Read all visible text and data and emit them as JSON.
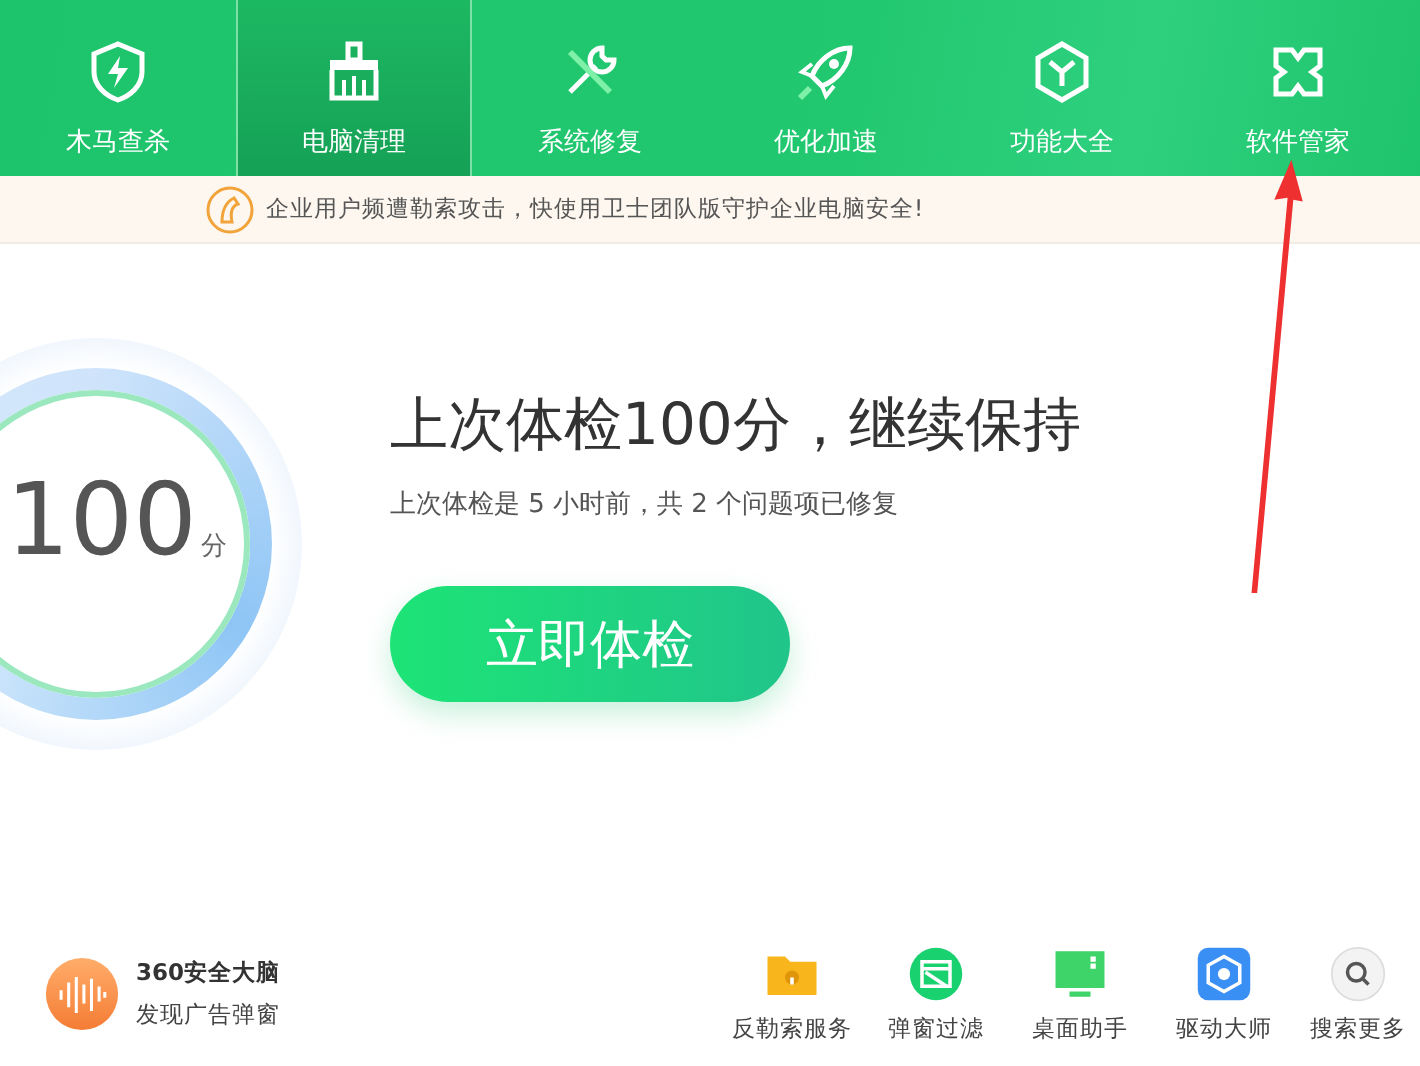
{
  "nav_tabs": [
    {
      "label": "木马查杀",
      "selected": false
    },
    {
      "label": "电脑清理",
      "selected": true
    },
    {
      "label": "系统修复",
      "selected": false
    },
    {
      "label": "优化加速",
      "selected": false
    },
    {
      "label": "功能大全",
      "selected": false
    },
    {
      "label": "软件管家",
      "selected": false
    }
  ],
  "notice": {
    "text": "企业用户频遭勒索攻击，快使用卫士团队版守护企业电脑安全!"
  },
  "score": {
    "value": "100",
    "unit": "分"
  },
  "summary": {
    "title": "上次体检100分，继续保持",
    "subtitle": "上次体检是 5 小时前，共 2 个问题项已修复"
  },
  "scan_button": "立即体检",
  "brain": {
    "title": "360安全大脑",
    "subtitle": "发现广告弹窗"
  },
  "tools": [
    {
      "label": "反勒索服务"
    },
    {
      "label": "弹窗过滤"
    },
    {
      "label": "桌面助手"
    },
    {
      "label": "驱动大师"
    },
    {
      "label": "搜索更多"
    }
  ]
}
